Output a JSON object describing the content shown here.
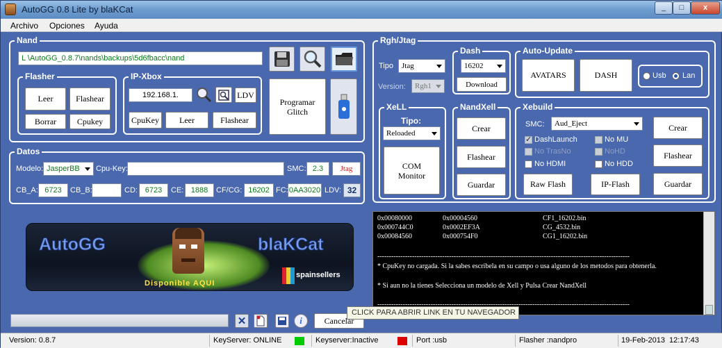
{
  "window": {
    "title": "AutoGG 0.8 Lite by blaKCat",
    "min": "_",
    "max": "□",
    "close": "x"
  },
  "menu": [
    "Archivo",
    "Opciones",
    "Ayuda"
  ],
  "nand": {
    "label": "Nand",
    "path": "L                                    \\AutoGG_0.8.7\\nands\\backups\\5d6fbacc\\nand",
    "flasher": {
      "label": "Flasher",
      "leer": "Leer",
      "flashear": "Flashear",
      "borrar": "Borrar",
      "cpukey": "Cpukey"
    },
    "ipxbox": {
      "label": "IP-Xbox",
      "ip": "192.168.1.",
      "ldv": "LDV",
      "cpukey": "CpuKey",
      "leer": "Leer",
      "flashear": "Flashear"
    },
    "programar": "Programar Glitch"
  },
  "datos": {
    "label": "Datos",
    "modelo_label": "Modelo:",
    "modelo": "JasperBB",
    "cpukey_label": "Cpu-Key:",
    "cpukey": "",
    "smc_label": "SMC:",
    "smc": "2.3",
    "smc_type": "Jtag",
    "cba_label": "CB_A:",
    "cba": "6723",
    "cbb_label": "CB_B:",
    "cbb": "",
    "cd_label": "CD:",
    "cd": "6723",
    "ce_label": "CE:",
    "ce": "1888",
    "cfcg_label": "CF/CG:",
    "cfcg": "16202",
    "fc_label": "FC:",
    "fc": "0AA3020",
    "ldv_label": "LDV:",
    "ldv": "32"
  },
  "rgh": {
    "label": "Rgh/Jtag",
    "tipo_label": "Tipo",
    "tipo": "Jtag",
    "version_label": "Version:",
    "version": "Rgh1",
    "dash": {
      "label": "Dash",
      "value": "16202",
      "download": "Download"
    },
    "auto_update": {
      "label": "Auto-Update",
      "avatars": "AVATARS",
      "dash": "DASH",
      "usb": "Usb",
      "lan": "Lan"
    },
    "xell": {
      "label": "XeLL",
      "tipo_label": "Tipo:",
      "tipo": "Reloaded",
      "com": "COM Monitor"
    },
    "nandxell": {
      "label": "NandXell",
      "crear": "Crear",
      "flashear": "Flashear",
      "guardar": "Guardar"
    },
    "xebuild": {
      "label": "Xebuild",
      "smc_label": "SMC:",
      "smc": "Aud_Eject",
      "dashlaunch": "DashLaunch",
      "no_mu": "No MU",
      "no_trash": "No TrasNo",
      "nohdd_dis": "NoHD",
      "no_hdmi": "No HDMI",
      "no_hdd": "No HDD",
      "raw_flash": "Raw Flash",
      "ip_flash": "IP-Flash",
      "crear": "Crear",
      "flashear": "Flashear",
      "guardar": "Guardar"
    }
  },
  "banner": {
    "left": "AutoGG",
    "right": "blaKCat",
    "available": "Disponible AQUI",
    "sponsor": "spainsellers"
  },
  "console": {
    "lines": [
      [
        "0x00080000",
        "0x00004560",
        "CF1_16202.bin"
      ],
      [
        "0x000744C0",
        "0x0002EF3A",
        "CG_4532.bin"
      ],
      [
        "0x00084560",
        "0x000754F0",
        "CG1_16202.bin"
      ]
    ],
    "dashes": "-------------------------------------------------------------------------------------------------------------",
    "msg1": "* CpuKey no cargada. Si la sabes escribela en su campo o usa alguno de los metodos para obtenerla.",
    "msg2": "* Si aun no la tienes Selecciona un modelo de Xell y Pulsa Crear NandXell"
  },
  "tooltip": "CLICK PARA ABRIR LINK EN TU NAVEGADOR",
  "cancel": "Cancelar",
  "status": {
    "version": "Version: 0.8.7",
    "keyserver": "KeyServer: ONLINE",
    "keyserver_inactive": "Keyserver:Inactive",
    "port": "Port :usb",
    "flasher": "Flasher :nandpro",
    "date": "19-Feb-2013",
    "time": "12:17:43",
    "green": "#00cc00",
    "red": "#dd0000"
  }
}
